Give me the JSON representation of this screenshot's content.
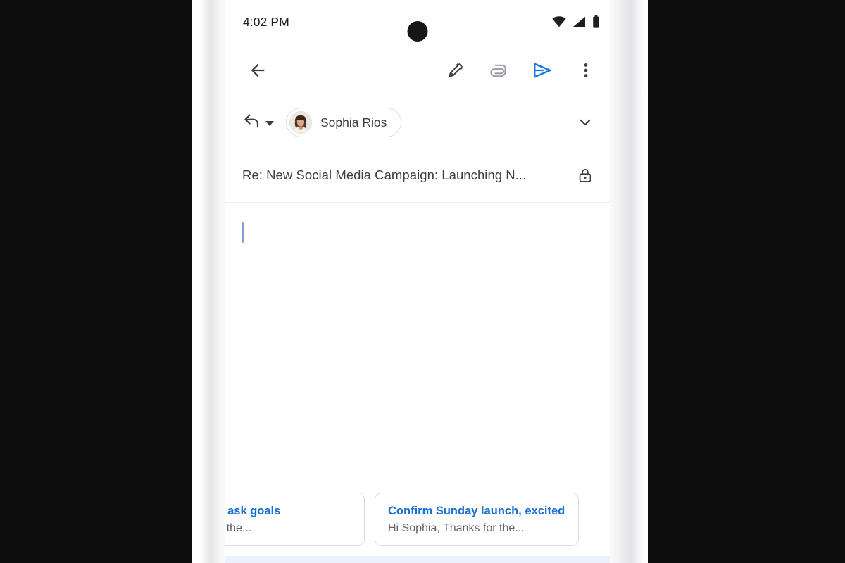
{
  "status_bar": {
    "time": "4:02 PM",
    "icons": [
      "wifi-icon",
      "cellular-signal-icon",
      "battery-icon"
    ],
    "camera": "front-camera-punch-hole"
  },
  "toolbar": {
    "back_label": "back-arrow",
    "actions": [
      {
        "name": "ai-compose-icon",
        "label": "Help me write"
      },
      {
        "name": "attach-icon",
        "label": "Attach file"
      },
      {
        "name": "send-icon",
        "label": "Send"
      },
      {
        "name": "overflow-menu-icon",
        "label": "More options"
      }
    ],
    "send_color": "#1a73e8"
  },
  "compose": {
    "reply_mode": "reply-arrow",
    "recipient": {
      "name": "Sophia Rios",
      "avatar": "contact-photo"
    },
    "expand_label": "expand-recipients",
    "subject": "Re: New Social Media Campaign: Launching N...",
    "encryption": "lock-icon",
    "body_text": "",
    "cursor_color": "#5f7bbf"
  },
  "suggestions": {
    "cards": [
      {
        "title": "y launch, ask goals",
        "subtitle": "o confirm, the..."
      },
      {
        "title": "Confirm Sunday launch, excited.",
        "subtitle": "Hi Sophia, Thanks for the..."
      }
    ],
    "accent_color": "#1a6fd4"
  }
}
